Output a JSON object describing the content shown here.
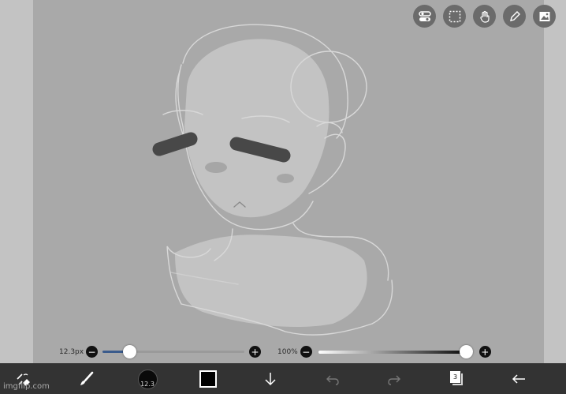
{
  "canvas": {
    "background": "#a9a9a9",
    "sketch_color": "#e2e2e2"
  },
  "top_tools": [
    {
      "name": "toggle-icon"
    },
    {
      "name": "selection-icon"
    },
    {
      "name": "hand-icon"
    },
    {
      "name": "pen-icon"
    },
    {
      "name": "image-icon"
    }
  ],
  "brush_slider": {
    "label": "12.3px",
    "value_fraction": 0.19,
    "minus": "−",
    "plus": "+"
  },
  "opacity_slider": {
    "label": "100%",
    "value_fraction": 1.0,
    "minus": "−",
    "plus": "+"
  },
  "toolbar": {
    "tools": [
      "pen-eraser-icon",
      "brush-icon",
      "brush-size",
      "color-swatch",
      "download-icon",
      "undo-icon",
      "redo-icon",
      "layers-icon",
      "back-icon"
    ],
    "brush_size_label": "12.3",
    "layer_count": "3",
    "primary_color": "#000000"
  },
  "watermark": "imgflip.com"
}
